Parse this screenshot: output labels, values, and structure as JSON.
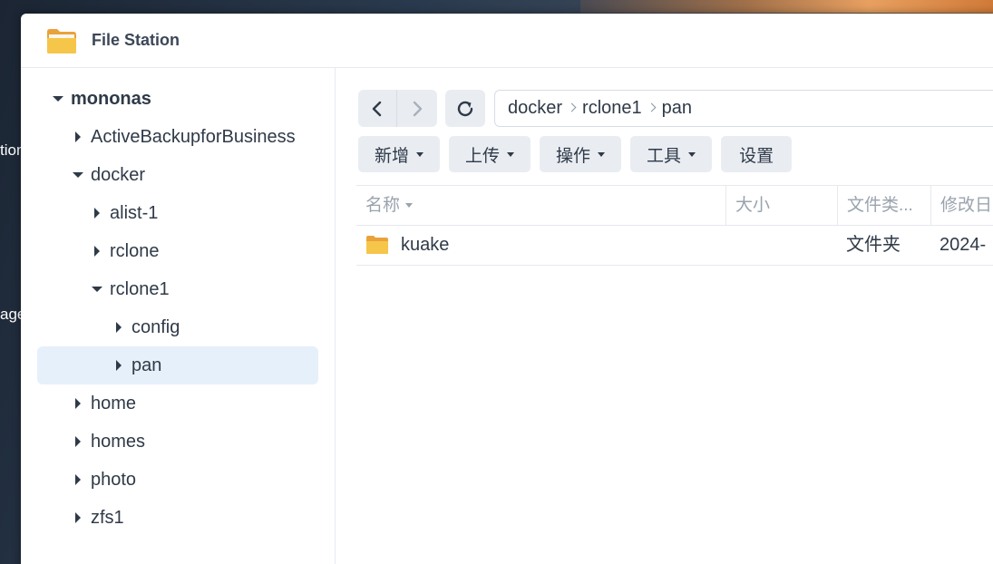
{
  "desktop": {
    "text1": "tion",
    "text2": "age"
  },
  "window": {
    "title": "File Station",
    "icon": "folder-icon"
  },
  "tree": [
    {
      "label": "mononas",
      "level": 0,
      "expanded": true,
      "bold": true
    },
    {
      "label": "ActiveBackupforBusiness",
      "level": 1,
      "expanded": false
    },
    {
      "label": "docker",
      "level": 1,
      "expanded": true
    },
    {
      "label": "alist-1",
      "level": 2,
      "expanded": false
    },
    {
      "label": "rclone",
      "level": 2,
      "expanded": false
    },
    {
      "label": "rclone1",
      "level": 2,
      "expanded": true
    },
    {
      "label": "config",
      "level": 3,
      "expanded": false
    },
    {
      "label": "pan",
      "level": 3,
      "expanded": false,
      "selected": true
    },
    {
      "label": "home",
      "level": 1,
      "expanded": false
    },
    {
      "label": "homes",
      "level": 1,
      "expanded": false
    },
    {
      "label": "photo",
      "level": 1,
      "expanded": false
    },
    {
      "label": "zfs1",
      "level": 1,
      "expanded": false
    }
  ],
  "breadcrumb": [
    "docker",
    "rclone1",
    "pan"
  ],
  "toolbar": {
    "create": "新增",
    "upload": "上传",
    "action": "操作",
    "tools": "工具",
    "settings": "设置"
  },
  "columns": {
    "name": "名称",
    "size": "大小",
    "type": "文件类...",
    "modified": "修改日"
  },
  "rows": [
    {
      "name": "kuake",
      "size": "",
      "type": "文件夹",
      "modified": "2024-",
      "icon": "folder-icon"
    }
  ],
  "colors": {
    "accent": "#e6f0fb",
    "folder": "#f5c242"
  }
}
